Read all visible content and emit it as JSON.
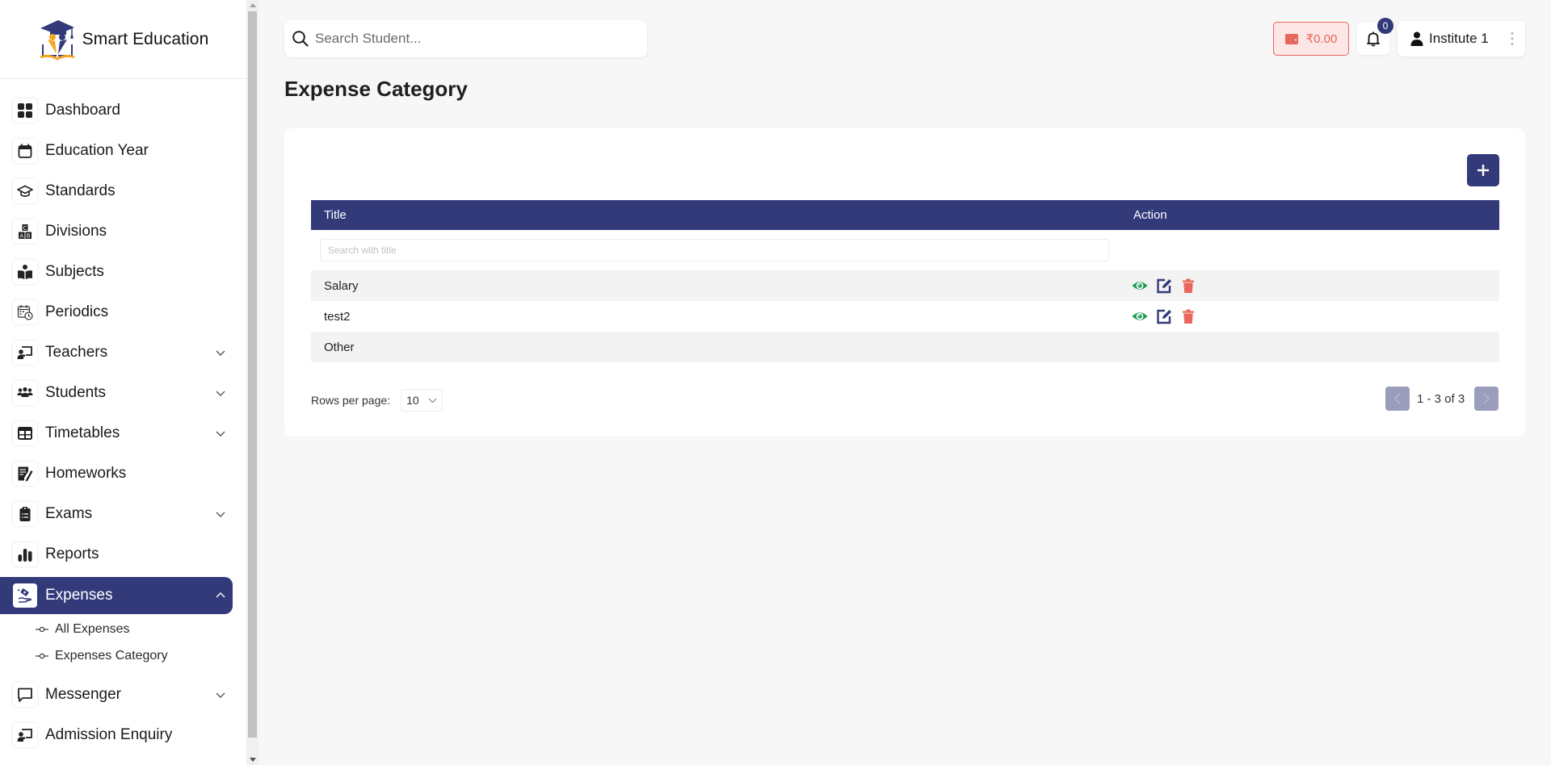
{
  "brand": {
    "name": "Smart Education",
    "logo": "graduation-logo"
  },
  "sidebar": {
    "items": [
      {
        "label": "Dashboard",
        "icon": "dashboard-grid-icon",
        "expandable": false
      },
      {
        "label": "Education Year",
        "icon": "calendar-icon",
        "expandable": false
      },
      {
        "label": "Standards",
        "icon": "graduation-cap-icon",
        "expandable": false
      },
      {
        "label": "Divisions",
        "icon": "abc-blocks-icon",
        "expandable": false
      },
      {
        "label": "Subjects",
        "icon": "reader-icon",
        "expandable": false
      },
      {
        "label": "Periodics",
        "icon": "calendar-clock-icon",
        "expandable": false
      },
      {
        "label": "Teachers",
        "icon": "teacher-board-icon",
        "expandable": true
      },
      {
        "label": "Students",
        "icon": "users-group-icon",
        "expandable": true
      },
      {
        "label": "Timetables",
        "icon": "table-icon",
        "expandable": true
      },
      {
        "label": "Homeworks",
        "icon": "notebook-pen-icon",
        "expandable": false
      },
      {
        "label": "Exams",
        "icon": "clipboard-list-icon",
        "expandable": true
      },
      {
        "label": "Reports",
        "icon": "bar-chart-icon",
        "expandable": false
      },
      {
        "label": "Expenses",
        "icon": "hand-money-icon",
        "expandable": true,
        "active": true
      },
      {
        "label": "Messenger",
        "icon": "chat-bubble-icon",
        "expandable": true
      },
      {
        "label": "Admission Enquiry",
        "icon": "teacher-board-icon",
        "expandable": false
      }
    ],
    "expenses_sub": [
      {
        "label": "All Expenses"
      },
      {
        "label": "Expenses Category"
      }
    ]
  },
  "topbar": {
    "search_placeholder": "Search Student...",
    "wallet_amount": "₹0.00",
    "notification_count": "0",
    "user_name": "Institute 1"
  },
  "page": {
    "title": "Expense Category"
  },
  "table": {
    "columns": [
      "Title",
      "Action"
    ],
    "filter_placeholder": "Search with title",
    "rows": [
      {
        "title": "Salary",
        "actions": [
          "view",
          "edit",
          "delete"
        ]
      },
      {
        "title": "test2",
        "actions": [
          "view",
          "edit",
          "delete"
        ]
      },
      {
        "title": "Other",
        "actions": []
      }
    ]
  },
  "pagination": {
    "rows_per_page_label": "Rows per page:",
    "rows_per_page": "10",
    "range": "1 - 3 of 3"
  },
  "colors": {
    "primary": "#333a7a",
    "view": "#1f9d55",
    "delete": "#e8665a",
    "wallet_bg": "#fde6e6",
    "pager_disabled": "#9b9dbd"
  }
}
